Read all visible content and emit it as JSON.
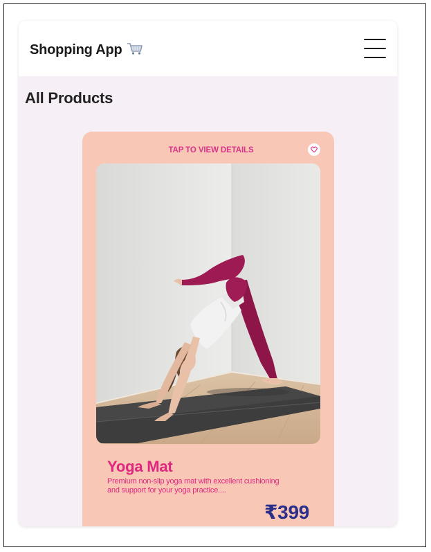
{
  "header": {
    "title": "Shopping App",
    "cart_icon": "shopping-cart-icon",
    "menu_icon": "hamburger-menu-icon"
  },
  "main": {
    "section_title": "All Products",
    "products": [
      {
        "hint": "TAP TO VIEW DETAILS",
        "wishlist_icon": "heart-icon",
        "name": "Yoga Mat",
        "description": "Premium non-slip yoga mat with excellent cushioning and support for your yoga practice....",
        "price": "₹399"
      }
    ]
  },
  "colors": {
    "card_background": "#f8c7b6",
    "accent_pink": "#e0267f",
    "price_blue": "#2b2f8a",
    "page_background": "#f6eff6"
  }
}
